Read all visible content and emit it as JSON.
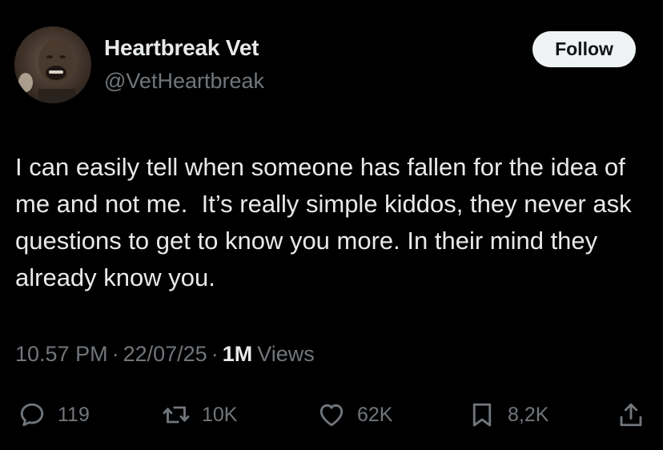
{
  "author": {
    "name": "Heartbreak Vet",
    "handle": "@VetHeartbreak",
    "avatar_icon": "profile-photo"
  },
  "follow_button": {
    "label": "Follow"
  },
  "tweet": {
    "text": "I can easily tell when someone has fallen for the idea of me and not me.  It’s really simple kiddos, they never ask questions to get to know you more. In their mind they already know you."
  },
  "meta": {
    "time": "10.57 PM",
    "separator": "·",
    "date": "22/07/25",
    "views_count": "1M",
    "views_label": "Views"
  },
  "actions": {
    "replies": {
      "icon": "reply-icon",
      "count": "119"
    },
    "reposts": {
      "icon": "retweet-icon",
      "count": "10K"
    },
    "likes": {
      "icon": "heart-icon",
      "count": "62K"
    },
    "bookmarks": {
      "icon": "bookmark-icon",
      "count": "8,2K"
    },
    "share": {
      "icon": "share-icon"
    }
  },
  "colors": {
    "background": "#000000",
    "primary_text": "#e7e9ea",
    "secondary_text": "#71767b",
    "follow_button_bg": "#eff3f4",
    "follow_button_text": "#0f1419"
  }
}
